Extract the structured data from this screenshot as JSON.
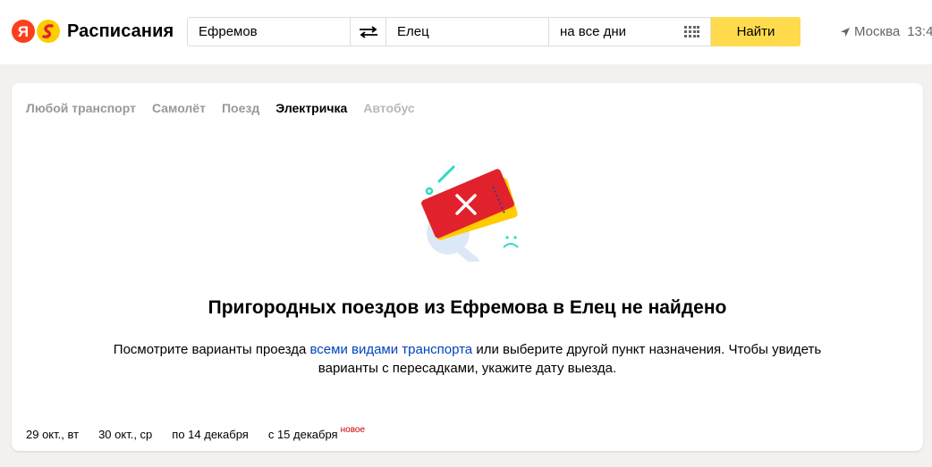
{
  "header": {
    "logo_letter": "Я",
    "logo_text": "Расписания",
    "from_value": "Ефремов",
    "to_value": "Елец",
    "date_value": "на все дни",
    "find_label": "Найти",
    "location_city": "Москва",
    "location_time": "13:4"
  },
  "tabs": [
    {
      "label": "Любой транспорт",
      "state": "normal"
    },
    {
      "label": "Самолёт",
      "state": "normal"
    },
    {
      "label": "Поезд",
      "state": "normal"
    },
    {
      "label": "Электричка",
      "state": "active"
    },
    {
      "label": "Автобус",
      "state": "disabled"
    }
  ],
  "empty_state": {
    "title": "Пригородных поездов из Ефремова в Елец не найдено",
    "desc_before": "Посмотрите варианты проезда ",
    "desc_link": "всеми видами транспорта",
    "desc_after": " или выберите другой пункт назначения. Чтобы увидеть варианты с пересадками, укажите дату выезда."
  },
  "dates": [
    {
      "label": "29 окт., вт",
      "active": false,
      "badge": ""
    },
    {
      "label": "30 окт., ср",
      "active": false,
      "badge": ""
    },
    {
      "label": "по 14 декабря",
      "active": true,
      "badge": ""
    },
    {
      "label": "с 15 декабря",
      "active": false,
      "badge": "новое"
    }
  ],
  "colors": {
    "accent_yellow": "#ffdb4d",
    "link": "#0044bb",
    "active_underline": "#e1222c",
    "logo_red": "#fc3f1d"
  }
}
